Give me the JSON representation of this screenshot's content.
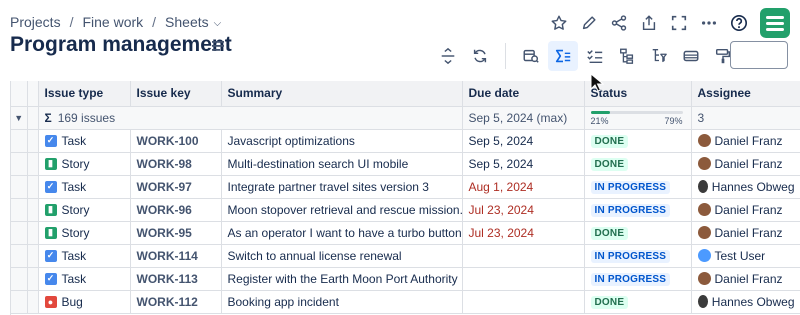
{
  "breadcrumb": {
    "items": [
      "Projects",
      "Fine work",
      "Sheets"
    ]
  },
  "page_title": "Program management",
  "colors": {
    "accent": "#0c66e4",
    "brand": "#22a06b",
    "done_bg": "#dcfff1",
    "progress_bg": "#e9f2ff",
    "overdue": "#ae2e24"
  },
  "top_actions": [
    "star-icon",
    "edit-icon",
    "share-icon",
    "export-icon",
    "fullscreen-icon",
    "more-icon",
    "help-icon"
  ],
  "toolbar": [
    "row-height-icon",
    "refresh-icon",
    "calendar-search-icon",
    "sum-icon",
    "checklist-icon",
    "hierarchy-icon",
    "hierarchy-filter-icon",
    "card-icon",
    "format-paint-icon"
  ],
  "table": {
    "columns": [
      "Issue type",
      "Issue key",
      "Summary",
      "Due date",
      "Status",
      "Assignee"
    ],
    "summary": {
      "issues": "169 issues",
      "due": "Sep 5, 2024 (max)",
      "progress_done": 0.21,
      "progress_left": "21%",
      "progress_right": "79%",
      "assignees": "3"
    },
    "rows": [
      {
        "type": "Task",
        "key": "WORK-100",
        "summary": "Javascript optimizations",
        "due": "Sep 5, 2024",
        "overdue": false,
        "status": "DONE",
        "assignee": "Daniel Franz"
      },
      {
        "type": "Story",
        "key": "WORK-98",
        "summary": "Multi-destination search UI mobile",
        "due": "Sep 5, 2024",
        "overdue": false,
        "status": "DONE",
        "assignee": "Daniel Franz"
      },
      {
        "type": "Task",
        "key": "WORK-97",
        "summary": "Integrate partner travel sites version 3",
        "due": "Aug 1, 2024",
        "overdue": true,
        "status": "IN PROGRESS",
        "assignee": "Hannes Obweg"
      },
      {
        "type": "Story",
        "key": "WORK-96",
        "summary": "Moon stopover retrieval and rescue mission...",
        "due": "Jul 23, 2024",
        "overdue": true,
        "status": "IN PROGRESS",
        "assignee": "Daniel Franz"
      },
      {
        "type": "Story",
        "key": "WORK-95",
        "summary": "As an operator I want to have a turbo button",
        "due": "Jul 23, 2024",
        "overdue": true,
        "status": "DONE",
        "assignee": "Daniel Franz"
      },
      {
        "type": "Task",
        "key": "WORK-114",
        "summary": "Switch to annual license renewal",
        "due": "",
        "overdue": false,
        "status": "IN PROGRESS",
        "assignee": "Test User"
      },
      {
        "type": "Task",
        "key": "WORK-113",
        "summary": "Register with the Earth Moon Port Authority",
        "due": "",
        "overdue": false,
        "status": "IN PROGRESS",
        "assignee": "Daniel Franz"
      },
      {
        "type": "Bug",
        "key": "WORK-112",
        "summary": "Booking app incident",
        "due": "",
        "overdue": false,
        "status": "DONE",
        "assignee": "Hannes Obweg"
      }
    ]
  }
}
